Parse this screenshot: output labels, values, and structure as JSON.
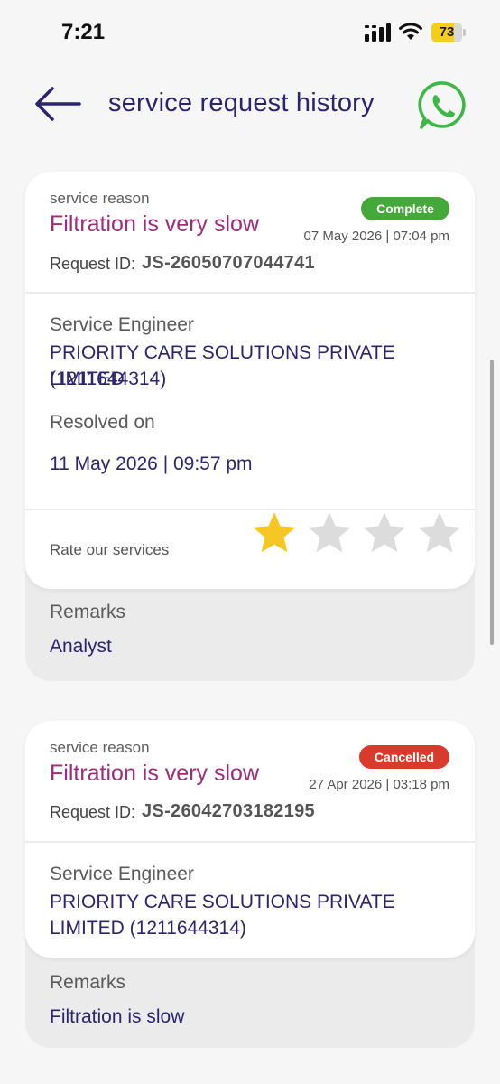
{
  "status_bar": {
    "time": "7:21",
    "battery_level": "73",
    "battery_percent": 73
  },
  "header": {
    "title": "service request history",
    "back_icon": "arrow-left-icon",
    "whatsapp_icon": "whatsapp-icon"
  },
  "requests": [
    {
      "reason_label": "service reason",
      "reason": "Filtration is very slow",
      "status": "Complete",
      "status_color": "#43a939",
      "date": "07 May 2026 | 07:04 pm",
      "request_id_label": "Request ID:",
      "request_id": "JS-26050707044741",
      "engineer_label": "Service Engineer",
      "engineer_line1": "PRIORITY CARE SOLUTIONS PRIVATE LIMITED",
      "engineer_line2": "(1211644314)",
      "resolved_label": "Resolved on",
      "resolved_on": "11 May 2026 | 09:57 pm",
      "rate_label": "Rate our services",
      "rating": 1,
      "rating_max": 5,
      "remarks_label": "Remarks",
      "remarks": "Analyst"
    },
    {
      "reason_label": "service reason",
      "reason": "Filtration is very slow",
      "status": "Cancelled",
      "status_color": "#d93a2b",
      "date": "27 Apr 2026 | 03:18 pm",
      "request_id_label": "Request ID:",
      "request_id": "JS-26042703182195",
      "engineer_label": "Service Engineer",
      "engineer_line1": "PRIORITY CARE SOLUTIONS PRIVATE",
      "engineer_line2": "LIMITED (1211644314)",
      "remarks_label": "Remarks",
      "remarks": "Filtration is slow"
    }
  ],
  "colors": {
    "primary": "#2d2470",
    "accent": "#a12a7d",
    "whatsapp": "#3cb847",
    "star_filled": "#f6c623",
    "star_empty": "#dcdcdc"
  }
}
